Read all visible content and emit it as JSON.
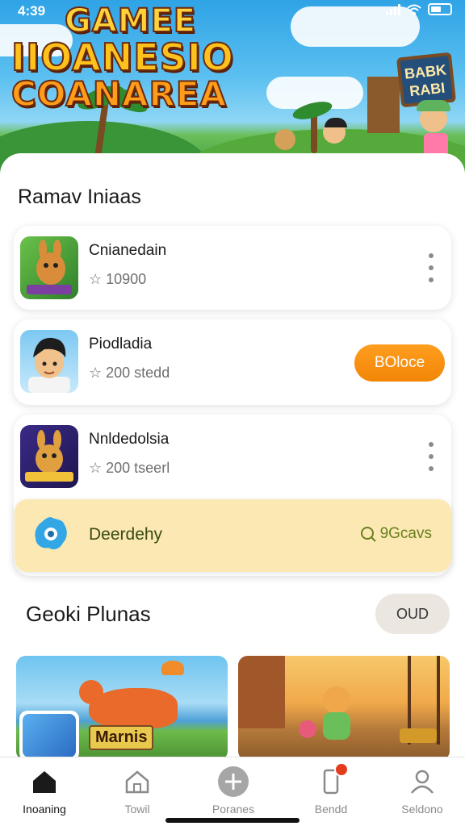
{
  "status_bar": {
    "time": "4:39"
  },
  "hero": {
    "title_lines": [
      "GAMEE",
      "IIOANESIO",
      "COANAREA"
    ],
    "sign_text": [
      "BABK",
      "RABI"
    ]
  },
  "section_title": "Ramav Iniaas",
  "apps": [
    {
      "name": "Cnianedain",
      "meta": "☆ 10900",
      "action": "menu",
      "icon": "kangaroo-icon"
    },
    {
      "name": "Piodladia",
      "meta": "☆ 200 stedd",
      "action": "install",
      "action_label": "BOloce",
      "icon": "avatar-icon"
    },
    {
      "name": "Nnldedolsia",
      "meta": "☆ 200 tseerl",
      "action": "menu",
      "icon": "kangaroo-icon"
    }
  ],
  "daily": {
    "label": "Deerdehy",
    "action_label": "9Gcavs",
    "icon": "star-badge-icon"
  },
  "section2": {
    "title": "Geoki Plunas",
    "more_label": "OUD"
  },
  "thumbnails": [
    {
      "label": "Marnis"
    },
    {
      "label": ""
    }
  ],
  "nav": [
    {
      "label": "Inoaning",
      "icon": "home-icon",
      "active": true
    },
    {
      "label": "Towil",
      "icon": "house-outline-icon"
    },
    {
      "label": "Poranes",
      "icon": "plus-icon"
    },
    {
      "label": "Bendd",
      "icon": "phone-icon",
      "badge": true
    },
    {
      "label": "Seldono",
      "icon": "profile-icon"
    }
  ],
  "colors": {
    "accent": "#f28506",
    "daily_bg": "#fbe8b2",
    "more_bg": "#ebe6e0"
  }
}
